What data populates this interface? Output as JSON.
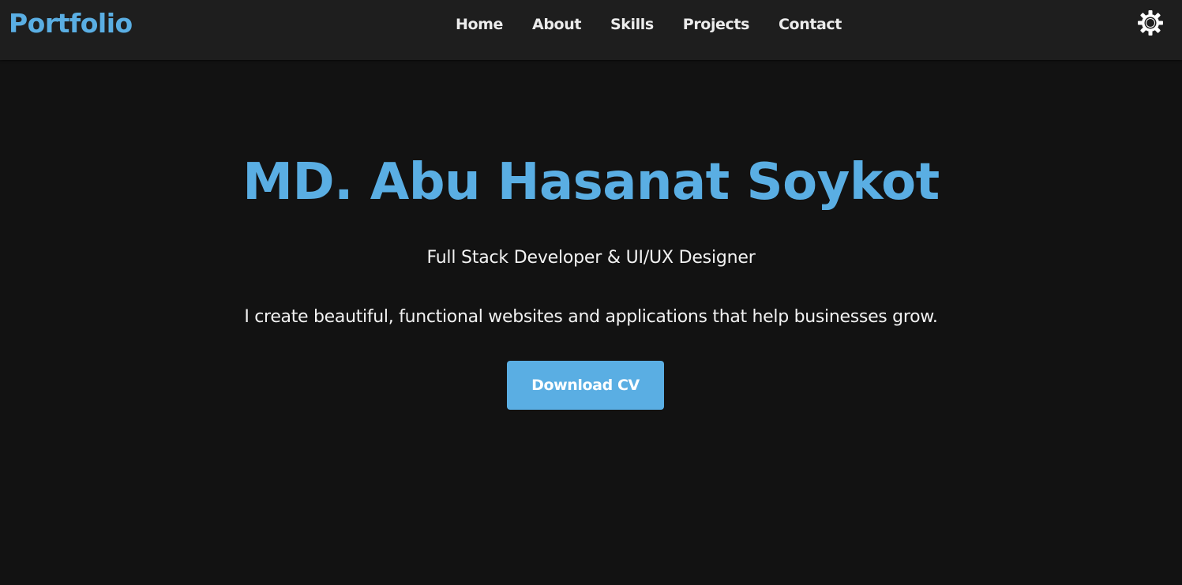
{
  "header": {
    "brand": "Portfolio",
    "nav": [
      {
        "label": "Home"
      },
      {
        "label": "About"
      },
      {
        "label": "Skills"
      },
      {
        "label": "Projects"
      },
      {
        "label": "Contact"
      }
    ],
    "theme_toggle_icon": "sun-icon"
  },
  "hero": {
    "name": "MD. Abu Hasanat Soykot",
    "role": "Full Stack Developer & UI/UX Designer",
    "tagline": "I create beautiful, functional websites and applications that help businesses grow.",
    "cta_label": "Download CV"
  },
  "colors": {
    "accent": "#5aaee3",
    "background": "#121212",
    "navbar": "#1e1e1e",
    "text": "#f2f2f2"
  }
}
